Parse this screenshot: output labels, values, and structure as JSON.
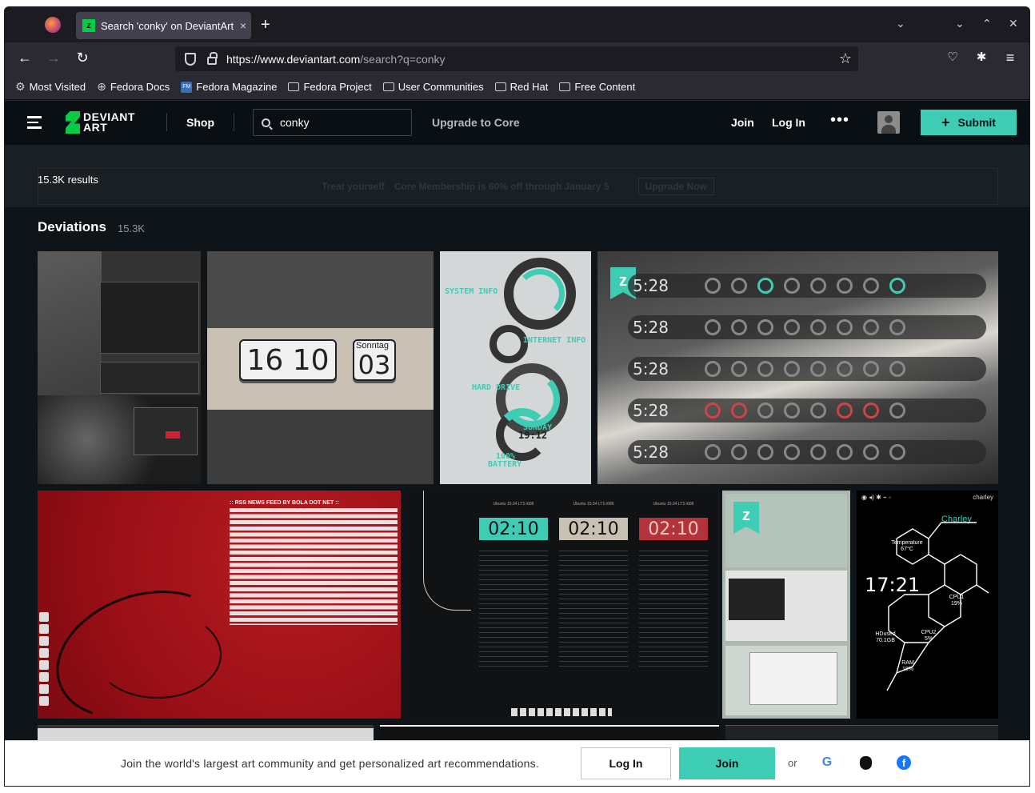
{
  "browser": {
    "tab_title": "Search 'conky' on DeviantArt",
    "tab_close": "×",
    "new_tab": "+",
    "url_host": "https://www.deviantart.com",
    "url_path": "/search?q=conky",
    "bookmarks": [
      {
        "label": "Most Visited",
        "icon": "gear-icon"
      },
      {
        "label": "Fedora Docs",
        "icon": "globe-icon"
      },
      {
        "label": "Fedora Magazine",
        "icon": "fedora-magazine-icon"
      },
      {
        "label": "Fedora Project",
        "icon": "folder-icon"
      },
      {
        "label": "User Communities",
        "icon": "folder-icon"
      },
      {
        "label": "Red Hat",
        "icon": "folder-icon"
      },
      {
        "label": "Free Content",
        "icon": "folder-icon"
      }
    ]
  },
  "header": {
    "logo_line1": "DEVIANT",
    "logo_line2": "ART",
    "shop": "Shop",
    "search_value": "conky",
    "upgrade": "Upgrade to Core",
    "join": "Join",
    "login": "Log In",
    "more": "•••",
    "submit": "Submit"
  },
  "results": {
    "count_text": "15.3K results",
    "promo_text": "Core Membership is 60% off through January 5",
    "promo_prefix": "Treat yourself",
    "promo_action": "Upgrade Now"
  },
  "section": {
    "title": "Deviations",
    "count": "15.3K"
  },
  "thumbs": {
    "flip_hours": "16",
    "flip_minutes": "10",
    "flip_day_label": "Sonntag",
    "flip_day": "03",
    "t3_labels": [
      "SYSTEM INFO",
      "INTERNET INFO",
      "HARD DRIVE",
      "SUNDAY",
      "19:12",
      "100%",
      "BATTERY"
    ],
    "t4_clock": "5:28",
    "t5_feed_title": ":: RSS NEWS FEED BY BOLA DOT NET ::",
    "t6_times": [
      "02:10",
      "02:10",
      "02:10"
    ],
    "t6_titles": [
      "Ubuntu 15.04 LTS i686",
      "Ubuntu 15.04 LTS i686",
      "Ubuntu 15.04 LTS i686"
    ],
    "t8_user": "charley",
    "t8_name": "Charley",
    "t8_time": "17:21",
    "t8_temp": "Temperature 67°C",
    "t8_cpu1": "CPU1 19%",
    "t8_cpu2": "CPU2 5%",
    "t8_hdd": "HDused 70.1GB",
    "t8_ram": "RAM 18%"
  },
  "banner": {
    "message": "Join the world's largest art community and get personalized art recommendations.",
    "login": "Log In",
    "join": "Join",
    "or": "or",
    "google": "G"
  },
  "colors": {
    "accent": "#3ecdb4",
    "page_bg": "#0f1419",
    "header_bg": "#0a0f13"
  }
}
